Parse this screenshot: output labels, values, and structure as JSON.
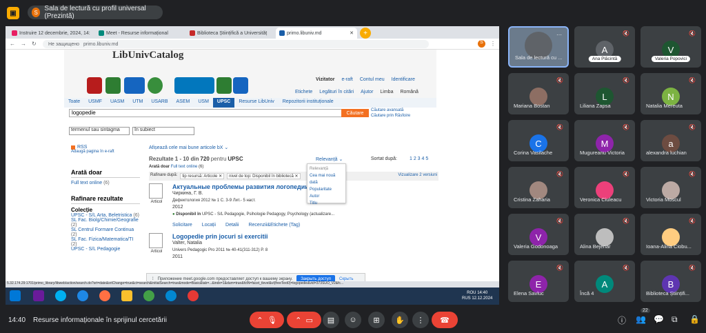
{
  "presentation_badge": {
    "avatar": "S",
    "label": "Sala de lectură cu profil universal (Prezintă)"
  },
  "browser": {
    "tabs": [
      {
        "label": "Instruire 12 decembrie, 2024, 14:",
        "color": "#e91e63"
      },
      {
        "label": "Meet - Resurse informațional",
        "color": "#00897b"
      },
      {
        "label": "Biblioteca Științifică a Universităț",
        "color": "#c62828"
      },
      {
        "label": "primo.libuniv.md",
        "color": "#1a5ea8"
      }
    ],
    "security": "Не защищено",
    "url": "primo.libuniv.md"
  },
  "library": {
    "title": "LibUnivCatalog",
    "vizitator": "Vizitator",
    "top_links": [
      "e-raft",
      "Contul meu",
      "Identificare"
    ],
    "links": [
      "Etichete",
      "Legături în citări",
      "Ajutor"
    ],
    "language_label": "Limba",
    "language": "Română",
    "tabs": [
      "Toate",
      "USMF",
      "UASM",
      "UTM",
      "USARB",
      "ASEM",
      "USM",
      "UPSC",
      "Resurse LibUniv",
      "Repozitorii instituționale"
    ],
    "selected_tab": "UPSC",
    "search_value": "logopedie",
    "search_button": "Căutare",
    "advanced_search": "Căutare avansată",
    "browse_search": "Căutare prin Răsfoire",
    "select1": "termenul sau sintagma",
    "select2": "în subiect",
    "rss": "RSS",
    "add_page": "Adaugă pagina în e-raft",
    "show_best": "Afișează cele mai bune articole bX",
    "results_label": "Rezultate 1 - 10 din",
    "results_count": "720",
    "results_for": "pentru",
    "results_scope": "UPSC",
    "sort_label": "Sortat după:",
    "sort_value": "Relevanță",
    "pages": "1 2 3 4 5",
    "show_only": "Arată doar",
    "full_text": "Full text online",
    "full_text_count": "(6)",
    "refine_label": "Rafinare după:",
    "chip1": "tip resursă: Articole",
    "chip2": "nivel de top: Disponibil în bibliotecă",
    "visualize": "Vizualizare 2 versiuni",
    "arata_doar_h": "Arată doar",
    "rafinare_h": "Rafinare rezultate",
    "colectie_h": "Colecție",
    "collections": [
      {
        "name": "UPSC - S/L Arta, Beletristica",
        "count": "(6)"
      },
      {
        "name": "SL Fac. Biolg/Chimie/Geografie",
        "count": "(2)"
      },
      {
        "name": "SL Centrul Formare Continua",
        "count": "(2)"
      },
      {
        "name": "SL Fac. Fizica/Matematica/TI",
        "count": "(2)"
      },
      {
        "name": "UPSC - S/L Pedagogie",
        "count": ""
      }
    ],
    "dropdown": [
      "Relevanță",
      "Cea mai nouă dată",
      "Popularitate",
      "Autor",
      "Titlu"
    ],
    "results": [
      {
        "title": "Актуальные проблемы развития логопедии",
        "author": "Чиркина, Г. В.",
        "source": "Дефектология 2012 № 1 С. 3-9 Лит.- 5 наст.",
        "year": "2012",
        "type": "Articol",
        "availability": "Disponibil în",
        "availability_detail": "UPSC - S/L Pedagogie, Psihologie  Pedagogy, Psychology  (actualizare...",
        "actions": [
          "Solicitare",
          "Locații",
          "Detalii",
          "Recenzii&Etichete (Tag)"
        ]
      },
      {
        "title": "Logopedie prin jocuri si exercitii",
        "author": "Valter, Natalia",
        "source": "Univers Pedagogic Pro 2011 № 40-41(311-312) P. 8",
        "year": "2011",
        "type": "Articol"
      }
    ],
    "share_text": "Приложение meet.google.com предоставляет доступ к вашему экрану.",
    "share_stop": "Закрыть доступ",
    "share_hide": "Скрыть",
    "status_url": "5.32.174.29:1701/primo_library/libweb/action/search.do?srt=date&srtChange=true&ct=search&initialSearch=true&mode=Basic&tab=...&indx=1&dum=true&fctN=facet_tlevel&vl(freeText0)=logopedie&vid=373SUO_V2&fc..."
  },
  "taskbar": {
    "lang": "ROU",
    "lang2": "RUS",
    "time": "14:40",
    "date": "12.12.2024"
  },
  "participants": [
    {
      "name": "Sala de lectură cu ...",
      "initial": "",
      "color": "#5f6368",
      "photo": true,
      "self": true
    },
    {
      "name": "Ana Plăcintă",
      "initial": "A",
      "color": "#5f6368",
      "pill": true
    },
    {
      "name": "Valeria Popovici",
      "initial": "V",
      "color": "#1e5631",
      "pill": true
    },
    {
      "name": "Mariana Bostan",
      "initial": "",
      "color": "#8d6e63",
      "photo": true
    },
    {
      "name": "Liliana Zapsa",
      "initial": "L",
      "color": "#1e5631"
    },
    {
      "name": "Natalia Mereuta",
      "initial": "N",
      "color": "#7cb342"
    },
    {
      "name": "Corina Vasilache",
      "initial": "C",
      "color": "#1a73e8"
    },
    {
      "name": "Mugureanu Victoria",
      "initial": "M",
      "color": "#8e24aa"
    },
    {
      "name": "alexandra luchian",
      "initial": "a",
      "color": "#6d4c41"
    },
    {
      "name": "Cristina Zaharia",
      "initial": "",
      "color": "#a1887f",
      "photo": true
    },
    {
      "name": "Veronica Ciuleacu",
      "initial": "",
      "color": "#ec407a",
      "photo": true
    },
    {
      "name": "Victoria Moscul",
      "initial": "",
      "color": "#bcaaa4",
      "photo": true
    },
    {
      "name": "Valeria Godonoaga",
      "initial": "V",
      "color": "#8e24aa"
    },
    {
      "name": "Alina Bejenar",
      "initial": "",
      "color": "#bdbdbd",
      "photo": true
    },
    {
      "name": "Ioana-Alina Ciobu...",
      "initial": "",
      "color": "#ffcc80",
      "photo": true
    },
    {
      "name": "Elena Savluc",
      "initial": "E",
      "color": "#8e24aa"
    },
    {
      "name": "Încă 4",
      "initial": "A",
      "color": "#00897b"
    },
    {
      "name": "Biblioteca Științifi...",
      "initial": "B",
      "color": "#5e35b1"
    }
  ],
  "bottom": {
    "time": "14:40",
    "title": "Resurse informaționale în sprijinul cercetării",
    "people_count": "22"
  }
}
